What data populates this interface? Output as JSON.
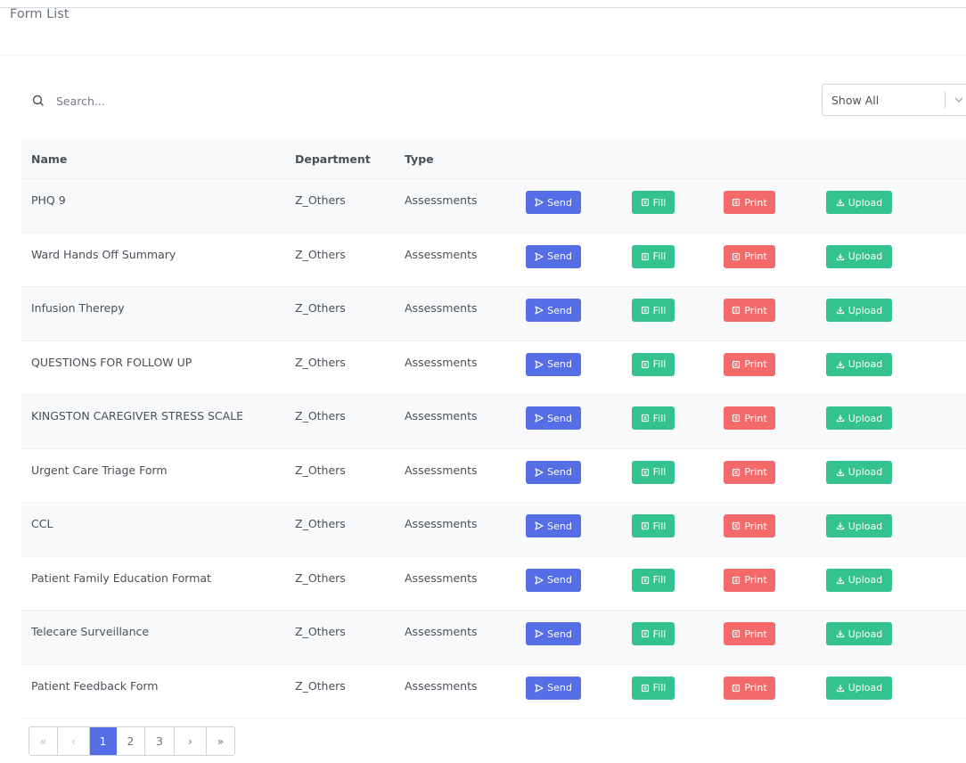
{
  "page": {
    "title": "Form List"
  },
  "search": {
    "placeholder": "Search..."
  },
  "filter": {
    "selected": "Show All"
  },
  "table": {
    "columns": [
      "Name",
      "Department",
      "Type"
    ],
    "actions": {
      "send": "Send",
      "fill": "Fill",
      "print": "Print",
      "upload": "Upload"
    },
    "rows": [
      {
        "name": "PHQ 9",
        "department": "Z_Others",
        "type": "Assessments"
      },
      {
        "name": "Ward Hands Off Summary",
        "department": "Z_Others",
        "type": "Assessments"
      },
      {
        "name": "Infusion Therepy",
        "department": "Z_Others",
        "type": "Assessments"
      },
      {
        "name": "QUESTIONS FOR FOLLOW UP",
        "department": "Z_Others",
        "type": "Assessments"
      },
      {
        "name": "KINGSTON CAREGIVER STRESS SCALE",
        "department": "Z_Others",
        "type": "Assessments"
      },
      {
        "name": "Urgent Care Triage Form",
        "department": "Z_Others",
        "type": "Assessments"
      },
      {
        "name": "CCL",
        "department": "Z_Others",
        "type": "Assessments"
      },
      {
        "name": "Patient Family Education Format",
        "department": "Z_Others",
        "type": "Assessments"
      },
      {
        "name": "Telecare Surveillance",
        "department": "Z_Others",
        "type": "Assessments"
      },
      {
        "name": "Patient Feedback Form",
        "department": "Z_Others",
        "type": "Assessments"
      }
    ]
  },
  "pagination": {
    "first": "«",
    "prev": "‹",
    "pages": [
      "1",
      "2",
      "3"
    ],
    "current": "1",
    "next": "›",
    "last": "»"
  },
  "colors": {
    "send": "#556ee6",
    "fill": "#34c38f",
    "print": "#f46a6a",
    "upload": "#34c38f",
    "active_page": "#556ee6"
  }
}
